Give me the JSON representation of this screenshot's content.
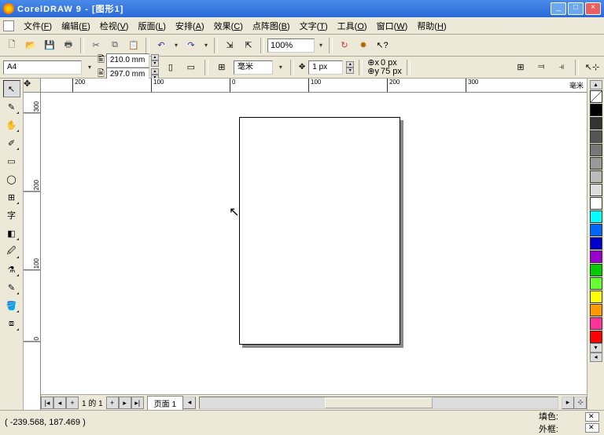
{
  "titlebar": {
    "app": "CorelDRAW 9",
    "doc": "[图形1]"
  },
  "menu": {
    "items": [
      {
        "label": "文件",
        "hot": "F"
      },
      {
        "label": "编辑",
        "hot": "E"
      },
      {
        "label": "检视",
        "hot": "V"
      },
      {
        "label": "版面",
        "hot": "L"
      },
      {
        "label": "安排",
        "hot": "A"
      },
      {
        "label": "效果",
        "hot": "C"
      },
      {
        "label": "点阵图",
        "hot": "B"
      },
      {
        "label": "文字",
        "hot": "T"
      },
      {
        "label": "工具",
        "hot": "O"
      },
      {
        "label": "窗口",
        "hot": "W"
      },
      {
        "label": "帮助",
        "hot": "H"
      }
    ]
  },
  "toolbar": {
    "zoom": "100%"
  },
  "propbar": {
    "paper": "A4",
    "width": "210.0 mm",
    "height": "297.0 mm",
    "units": "毫米",
    "nudge": "1 px",
    "dup_x": "0 px",
    "dup_y": "75 px"
  },
  "ruler": {
    "h_ticks": [
      "200",
      "100",
      "0",
      "100",
      "200",
      "300"
    ],
    "v_ticks": [
      "300",
      "200",
      "100",
      "0"
    ],
    "unit_label": "毫米"
  },
  "pagenav": {
    "pos": "1 的 1",
    "tab": "页面  1"
  },
  "status": {
    "coords": "( -239.568, 187.469 )",
    "fill_label": "填色:",
    "outline_label": "外框:"
  },
  "palette": {
    "colors": [
      "#000000",
      "#333333",
      "#555555",
      "#777777",
      "#999999",
      "#bbbbbb",
      "#dddddd",
      "#ffffff",
      "#00ffff",
      "#0066ff",
      "#0000cc",
      "#9900cc",
      "#00cc00",
      "#66ff33",
      "#ffff00",
      "#ff9900",
      "#ff3399",
      "#ff0000"
    ]
  },
  "chart_data": null
}
